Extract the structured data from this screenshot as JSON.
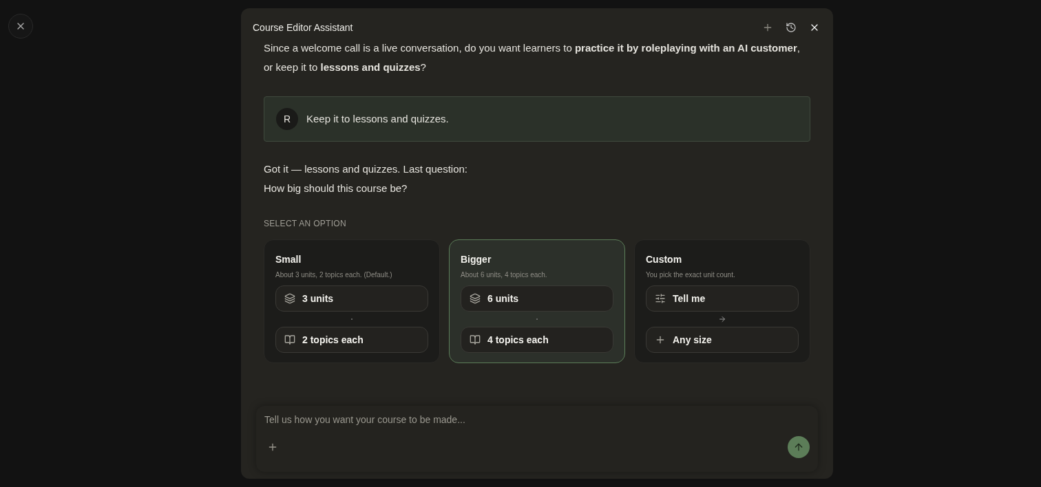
{
  "window": {
    "title": "Course Editor Assistant"
  },
  "messages": [
    {
      "kind": "assistant",
      "paragraphs": [
        "Since a welcome call is a live conversation, do you want learners to **practice it by roleplaying with an AI customer**,",
        "or keep it to **lessons and quizzes**?"
      ]
    },
    {
      "kind": "user",
      "avatar": "R",
      "text": "Keep it to lessons and quizzes."
    },
    {
      "kind": "assistant",
      "paragraphs": [
        "Got it — lessons and quizzes. Last question:",
        "How big should this course be?"
      ]
    }
  ],
  "options": {
    "label": "SELECT AN OPTION",
    "items": [
      {
        "title": "Small",
        "description": "About 3 units, 2 topics each. (Default.)",
        "selected": false,
        "chips": [
          {
            "label": "3 units"
          },
          {
            "label": "2 topics each"
          }
        ]
      },
      {
        "title": "Bigger",
        "description": "About 6 units, 4 topics each.",
        "selected": true,
        "chips": [
          {
            "label": "6 units"
          },
          {
            "label": "4 topics each"
          }
        ]
      },
      {
        "title": "Custom",
        "description": "You pick the exact unit count.",
        "selected": false,
        "chips": [
          {
            "label": "Tell me"
          },
          {
            "label": "Any size"
          }
        ]
      }
    ]
  },
  "composer": {
    "placeholder": "Tell us how you want your course to be made..."
  }
}
